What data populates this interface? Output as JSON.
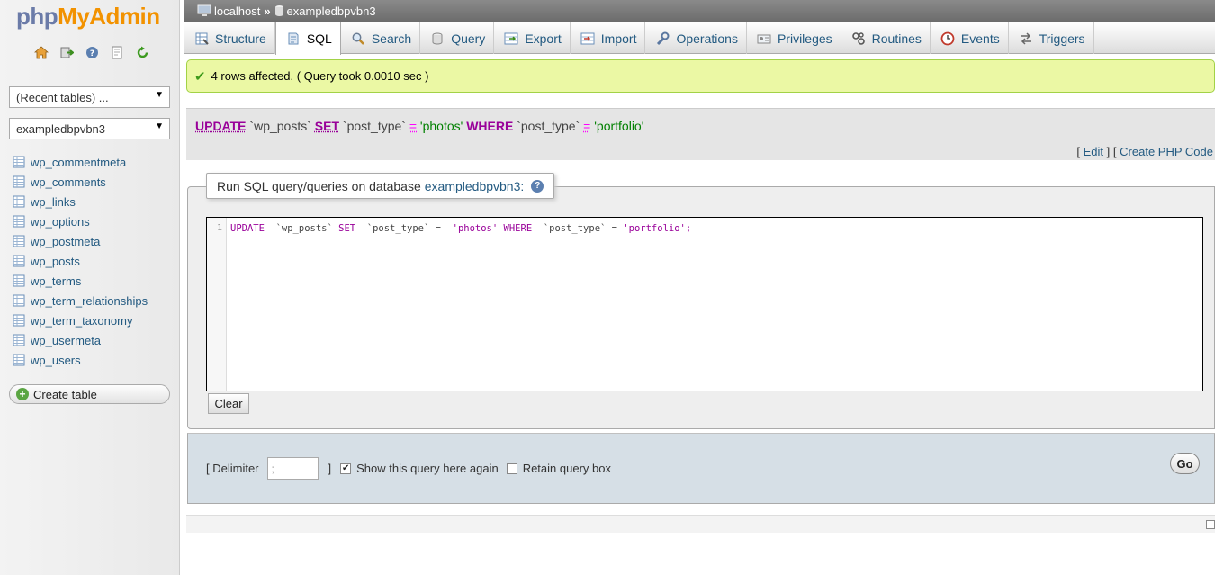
{
  "sidebar": {
    "logo": {
      "php": "php",
      "myadmin": "MyAdmin"
    },
    "icons": [
      "home-icon",
      "exit-icon",
      "help-icon",
      "docs-icon",
      "reload-icon"
    ],
    "recent_tables": "(Recent tables) ...",
    "database_select": "exampledbpvbn3",
    "tables": [
      "wp_commentmeta",
      "wp_comments",
      "wp_links",
      "wp_options",
      "wp_postmeta",
      "wp_posts",
      "wp_terms",
      "wp_term_relationships",
      "wp_term_taxonomy",
      "wp_usermeta",
      "wp_users"
    ],
    "create_table": "Create table"
  },
  "breadcrumb": {
    "server": "localhost",
    "separator": "»",
    "database": "exampledbpvbn3"
  },
  "tabs": [
    {
      "label": "Structure",
      "icon": "structure-icon"
    },
    {
      "label": "SQL",
      "icon": "sql-icon",
      "active": true
    },
    {
      "label": "Search",
      "icon": "search-icon"
    },
    {
      "label": "Query",
      "icon": "query-icon"
    },
    {
      "label": "Export",
      "icon": "export-icon"
    },
    {
      "label": "Import",
      "icon": "import-icon"
    },
    {
      "label": "Operations",
      "icon": "wrench-icon"
    },
    {
      "label": "Privileges",
      "icon": "privileges-icon"
    },
    {
      "label": "Routines",
      "icon": "routines-icon"
    },
    {
      "label": "Events",
      "icon": "clock-icon"
    },
    {
      "label": "Triggers",
      "icon": "triggers-icon"
    }
  ],
  "message": {
    "text": "4 rows affected. ( Query took 0.0010 sec )",
    "color": "#ebf8a4"
  },
  "sql_display": {
    "update": "UPDATE",
    "table": "`wp_posts`",
    "set": "SET",
    "column": "`post_type`",
    "eq": "=",
    "value1": "'photos'",
    "where": "WHERE",
    "column2": "`post_type`",
    "eq2": "=",
    "value2": "'portfolio'",
    "edit_link": "Edit",
    "php_link": "Create PHP Code",
    "bracket_open": "[",
    "bracket_close": "]"
  },
  "query_box": {
    "legend": "Run SQL query/queries on database",
    "database": "exampledbpvbn3:",
    "line_number": "1",
    "code": {
      "k1": "UPDATE",
      "i1": "`wp_posts`",
      "k2": "SET",
      "i2": "`post_type`",
      "eq": "=",
      "s1": "'photos'",
      "k3": "WHERE",
      "i3": "`post_type`",
      "eq2": "=",
      "s2": "'portfolio';"
    },
    "clear_button": "Clear"
  },
  "options": {
    "delimiter_label": "[ Delimiter",
    "delimiter_value": ";",
    "delimiter_close": "]",
    "show_query_label": "Show this query here again",
    "show_query_checked": true,
    "retain_label": "Retain query box",
    "retain_checked": false,
    "go_button": "Go"
  }
}
